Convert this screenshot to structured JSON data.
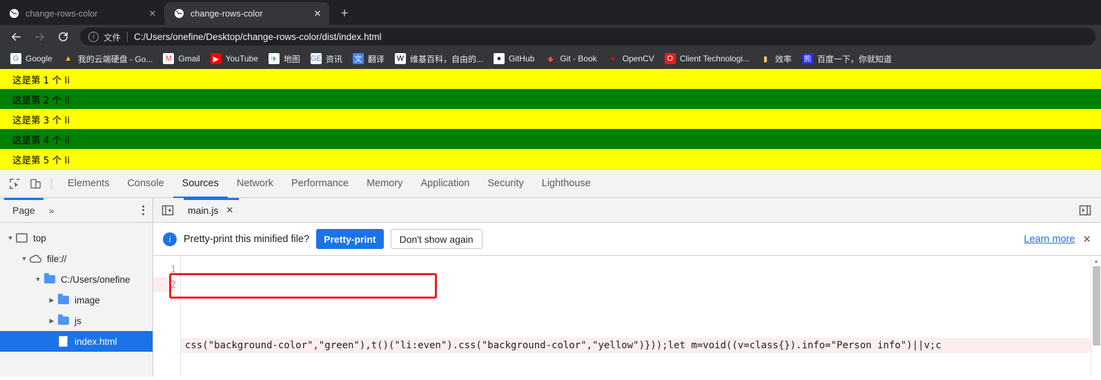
{
  "browser": {
    "tabs": [
      {
        "title": "change-rows-color",
        "favicon": "globe-icon",
        "active": false,
        "close": "✕"
      },
      {
        "title": "change-rows-color",
        "favicon": "globe-icon",
        "active": true,
        "close": "✕"
      }
    ],
    "new_tab_label": "+",
    "nav": {
      "back": "←",
      "forward": "→",
      "reload": "↻"
    },
    "omnibox": {
      "info_glyph": "i",
      "scheme_label": "文件",
      "url": "C:/Users/onefine/Desktop/change-rows-color/dist/index.html"
    },
    "bookmarks": [
      {
        "label": "Google",
        "icon": "google-icon",
        "glyph": "G",
        "fg": "#4285f4",
        "bg": "#ffffff"
      },
      {
        "label": "我的云端硬盘 - Go...",
        "icon": "google-drive-icon",
        "glyph": "▲",
        "fg": "#fbbc04",
        "bg": "transparent"
      },
      {
        "label": "Gmail",
        "icon": "gmail-icon",
        "glyph": "M",
        "fg": "#ea4335",
        "bg": "#ffffff"
      },
      {
        "label": "YouTube",
        "icon": "youtube-icon",
        "glyph": "▶",
        "fg": "#ffffff",
        "bg": "#ff0000"
      },
      {
        "label": "地图",
        "icon": "google-maps-icon",
        "glyph": "✈",
        "fg": "#34a853",
        "bg": "#ffffff"
      },
      {
        "label": "资讯",
        "icon": "google-news-icon",
        "glyph": "GE",
        "fg": "#4285f4",
        "bg": "#ffffff"
      },
      {
        "label": "翻译",
        "icon": "google-translate-icon",
        "glyph": "文",
        "fg": "#ffffff",
        "bg": "#4285f4"
      },
      {
        "label": "维基百科，自由的...",
        "icon": "wikipedia-icon",
        "glyph": "W",
        "fg": "#000000",
        "bg": "#ffffff"
      },
      {
        "label": "GitHub",
        "icon": "github-icon",
        "glyph": "●",
        "fg": "#24292e",
        "bg": "#ffffff"
      },
      {
        "label": "Git - Book",
        "icon": "git-icon",
        "glyph": "◆",
        "fg": "#f05133",
        "bg": "transparent"
      },
      {
        "label": "OpenCV",
        "icon": "opencv-icon",
        "glyph": "●",
        "fg": "#ff0000",
        "bg": "transparent"
      },
      {
        "label": "Client Technologi...",
        "icon": "oracle-icon",
        "glyph": "O",
        "fg": "#ffffff",
        "bg": "#e02020"
      },
      {
        "label": "效率",
        "icon": "folder-bookmark-icon",
        "glyph": "▮",
        "fg": "#f3c969",
        "bg": "transparent"
      },
      {
        "label": "百度一下，你就知道",
        "icon": "baidu-icon",
        "glyph": "熊",
        "fg": "#ffffff",
        "bg": "#2932e1"
      }
    ]
  },
  "page": {
    "list_items": [
      {
        "text": "这是第 1 个 li",
        "bg": "#ffff00"
      },
      {
        "text": "这是第 2 个 li",
        "bg": "#008000"
      },
      {
        "text": "这是第 3 个 li",
        "bg": "#ffff00"
      },
      {
        "text": "这是第 4 个 li",
        "bg": "#008000"
      },
      {
        "text": "这是第 5 个 li",
        "bg": "#ffff00"
      }
    ],
    "colors": {
      "yellow": "#ffff00",
      "green": "#008000"
    }
  },
  "devtools": {
    "inspect_icon": "inspect-element-icon",
    "device_icon": "toggle-device-toolbar-icon",
    "tabs": [
      {
        "label": "Elements",
        "active": false
      },
      {
        "label": "Console",
        "active": false
      },
      {
        "label": "Sources",
        "active": true
      },
      {
        "label": "Network",
        "active": false
      },
      {
        "label": "Performance",
        "active": false
      },
      {
        "label": "Memory",
        "active": false
      },
      {
        "label": "Application",
        "active": false
      },
      {
        "label": "Security",
        "active": false
      },
      {
        "label": "Lighthouse",
        "active": false
      }
    ],
    "navigator": {
      "tab_label": "Page",
      "more_glyph": "»",
      "tree": [
        {
          "label": "top",
          "indent": 0,
          "twisty": "▼",
          "icon": "frame-icon",
          "selected": false
        },
        {
          "label": "file://",
          "indent": 1,
          "twisty": "▼",
          "icon": "cloud-icon",
          "selected": false
        },
        {
          "label": "C:/Users/onefine",
          "indent": 2,
          "twisty": "▼",
          "icon": "folder-icon",
          "selected": false
        },
        {
          "label": "image",
          "indent": 3,
          "twisty": "▶",
          "icon": "folder-icon",
          "selected": false
        },
        {
          "label": "js",
          "indent": 3,
          "twisty": "▶",
          "icon": "folder-icon",
          "selected": false
        },
        {
          "label": "index.html",
          "indent": 3,
          "twisty": "",
          "icon": "file-icon",
          "selected": true
        }
      ]
    },
    "editor": {
      "sidebar_toggle_icon": "show-navigator-icon",
      "right_sidebar_toggle_icon": "show-debugger-sidebar-icon",
      "file_tab": {
        "label": "main.js",
        "close": "✕"
      },
      "infobar": {
        "icon_glyph": "i",
        "message": "Pretty-print this minified file?",
        "primary_button": "Pretty-print",
        "secondary_button": "Don't show again",
        "learn_more": "Learn more",
        "close": "✕"
      },
      "line_numbers": [
        "1",
        "2"
      ],
      "code_line_2": "css(\"background-color\",\"green\"),t()(\"li:even\").css(\"background-color\",\"yellow\")}));let m=void((v=class{}).info=\"Person info\")||v;c"
    },
    "annotation": {
      "type": "red-rectangle",
      "color": "#ee1c25"
    }
  }
}
